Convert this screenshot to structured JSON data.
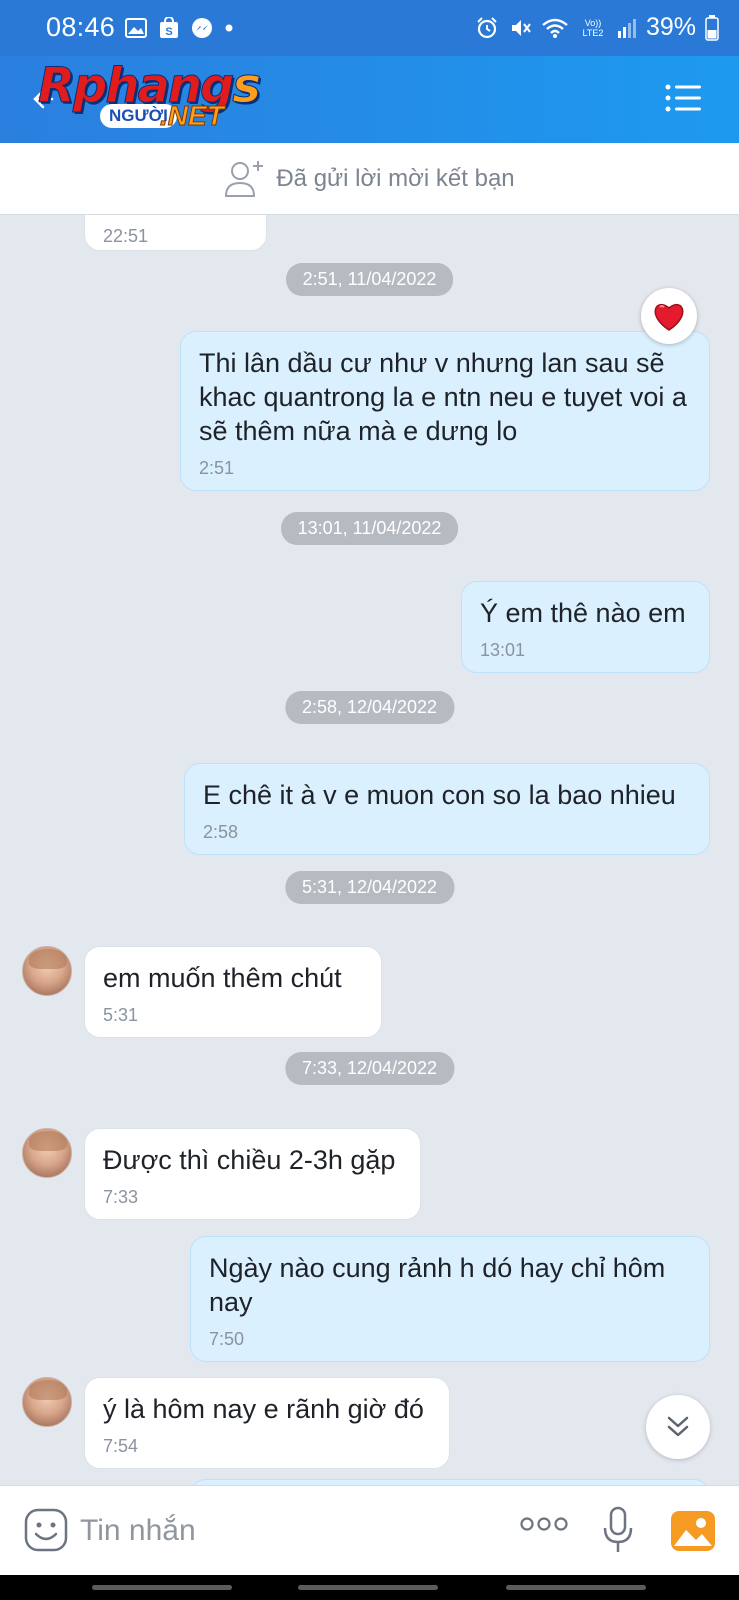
{
  "status_bar": {
    "time": "08:46",
    "battery": "39%",
    "network": "Vo)) LTE2"
  },
  "header": {
    "logo_main": "Rphang",
    "logo_s": "s",
    "logo_sub": "NGƯỜI",
    "logo_net": ".NET",
    "accent_color": "#2a79d6"
  },
  "friend_bar": {
    "label": "Đã gửi lời mời kết bạn"
  },
  "chat": {
    "partial_time": "22:51",
    "dates": [
      "2:51, 11/04/2022",
      "13:01, 11/04/2022",
      "2:58, 12/04/2022",
      "5:31, 12/04/2022",
      "7:33, 12/04/2022"
    ],
    "messages": [
      {
        "dir": "out",
        "text": "Thi lân dầu cư như v nhưng lan sau sẽ khac quantrong la e ntn neu e tuyet voi a sẽ  thêm nữa mà e dưng lo",
        "time": "2:51",
        "reaction": "heart"
      },
      {
        "dir": "out",
        "text": "Ý em thê nào em",
        "time": "13:01"
      },
      {
        "dir": "out",
        "text": "E chê it à v e muon con so la bao nhieu",
        "time": "2:58"
      },
      {
        "dir": "in",
        "text": "em muốn thêm chút",
        "time": "5:31"
      },
      {
        "dir": "in",
        "text": "Được thì chiều 2-3h gặp",
        "time": "7:33"
      },
      {
        "dir": "out",
        "text": "Ngày nào cung rảnh h dó hay chỉ hôm nay",
        "time": "7:50"
      },
      {
        "dir": "in",
        "text": "ý là hôm nay e rãnh giờ đó",
        "time": "7:54"
      }
    ]
  },
  "input_bar": {
    "placeholder": "Tin nhắn"
  },
  "colors": {
    "incoming_bubble": "#ffffff",
    "outgoing_bubble": "#daf0fe",
    "chat_bg": "#e3e7ee",
    "date_pill": "#b6bac1"
  }
}
